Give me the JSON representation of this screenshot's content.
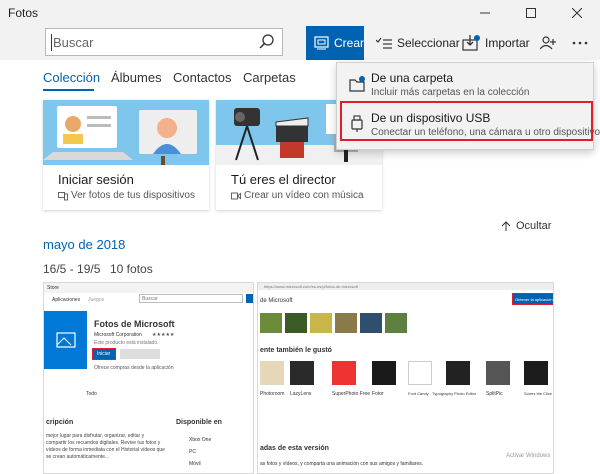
{
  "window": {
    "title": "Fotos"
  },
  "toolbar": {
    "search_placeholder": "Buscar",
    "crear_label": "Crear",
    "seleccionar_label": "Seleccionar",
    "importar_label": "Importar"
  },
  "tabs": [
    {
      "label": "Colección"
    },
    {
      "label": "Álbumes"
    },
    {
      "label": "Contactos"
    },
    {
      "label": "Carpetas"
    }
  ],
  "cards": [
    {
      "title": "Iniciar sesión",
      "subtitle": "Ver fotos de tus dispositivos"
    },
    {
      "title": "Tú eres el director",
      "subtitle": "Crear un vídeo con música"
    }
  ],
  "hide_label": "Ocultar",
  "gallery": {
    "month": "mayo de 2018",
    "range": "16/5 - 19/5",
    "count": "10 fotos"
  },
  "import_menu": [
    {
      "title": "De una carpeta",
      "subtitle": "Incluir más carpetas en la colección"
    },
    {
      "title": "De un dispositivo USB",
      "subtitle": "Conectar un teléfono, una cámara u otro dispositivo"
    }
  ],
  "thumb_left": {
    "store_label": "Store",
    "tab_apps": "Aplicaciones",
    "tab_games": "Juegos",
    "search": "Buscar",
    "app_title": "Fotos de Microsoft",
    "publisher": "Microsoft Corporation",
    "installed_note": "Este producto está instalado.",
    "install_btn": "Iniciar",
    "offer_note": "Ofrece compras desde la aplicación",
    "description_heading": "cripción",
    "available_heading": "Disponible en",
    "description_text": "mejor lugar para disfrutar, organizar, editar y compartir los recuerdos digitales. Revive tus fotos y vídeos de forma inmediata con el Historial vídeos que se crean automáticamente...",
    "devices": [
      "Xbox One",
      "PC",
      "Móvil"
    ],
    "todo_label": "Todo"
  },
  "thumb_right": {
    "url_text": "https://www.microsoft.com/es-es/p/fotos-de-microsoft",
    "ms_label": "de Microsoft",
    "get_btn": "Obtener la aplicación",
    "also_liked": "ente también le gustó",
    "apps": [
      "Photoroom",
      "LazyLens",
      "SuperPhoto Free",
      "Fotor",
      "Font Candy - Typography Photo Editor",
      "SplitPic",
      "Sones the Clive"
    ],
    "version_heading": "adas de esta versión",
    "version_text": "as fotos y vídeos, y comparta una animación con sus amigos y familiares.",
    "watermark": "Activar Windows"
  }
}
